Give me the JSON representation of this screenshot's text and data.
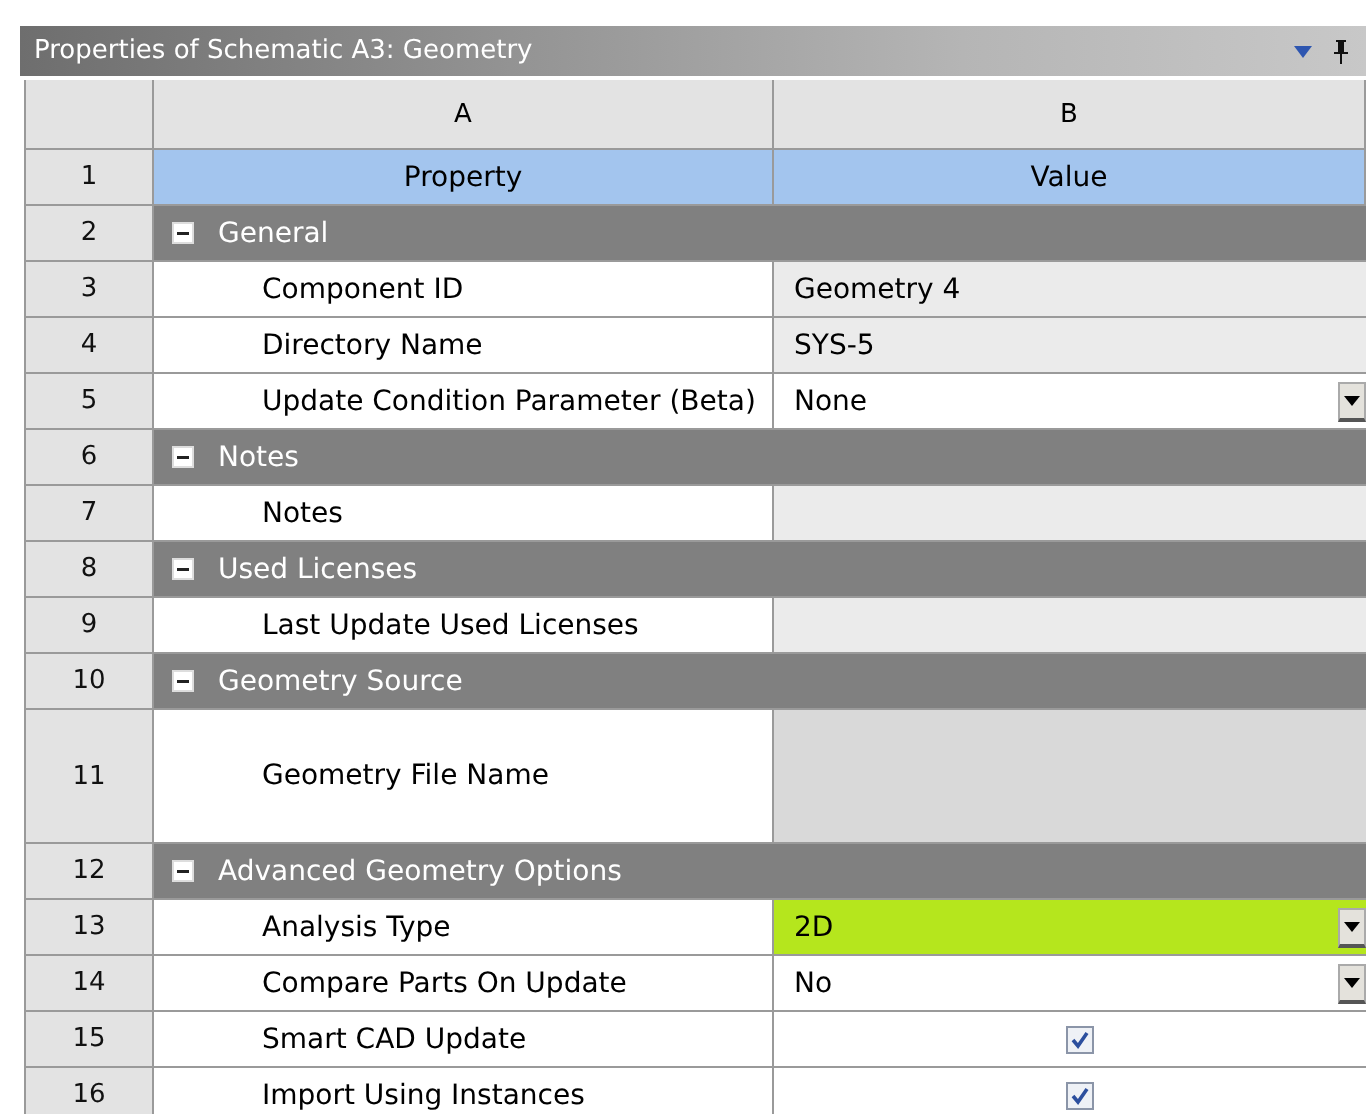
{
  "panel": {
    "title": "Properties of Schematic A3: Geometry"
  },
  "columns": [
    "A",
    "B"
  ],
  "header": {
    "number": "1",
    "property": "Property",
    "value": "Value"
  },
  "rows": [
    {
      "number": "2",
      "kind": "section",
      "label": "General",
      "expanded": true
    },
    {
      "number": "3",
      "kind": "readonly",
      "label": "Component ID",
      "value": "Geometry 4"
    },
    {
      "number": "4",
      "kind": "readonly",
      "label": "Directory Name",
      "value": "SYS-5"
    },
    {
      "number": "5",
      "kind": "dropdown",
      "label": "Update Condition Parameter (Beta)",
      "value": "None",
      "highlighted": false
    },
    {
      "number": "6",
      "kind": "section",
      "label": "Notes",
      "expanded": true
    },
    {
      "number": "7",
      "kind": "readonly",
      "label": "Notes"
    },
    {
      "number": "8",
      "kind": "section",
      "label": "Used Licenses",
      "expanded": true
    },
    {
      "number": "9",
      "kind": "readonly",
      "label": "Last Update Used Licenses"
    },
    {
      "number": "10",
      "kind": "section",
      "label": "Geometry Source",
      "expanded": true
    },
    {
      "number": "11",
      "kind": "file",
      "label": "Geometry File Name"
    },
    {
      "number": "12",
      "kind": "section",
      "label": "Advanced Geometry Options",
      "expanded": true
    },
    {
      "number": "13",
      "kind": "dropdown",
      "label": "Analysis Type",
      "value": "2D",
      "highlighted": true
    },
    {
      "number": "14",
      "kind": "dropdown",
      "label": "Compare Parts On Update",
      "value": "No",
      "highlighted": false
    },
    {
      "number": "15",
      "kind": "checkbox",
      "label": "Smart CAD Update",
      "checked": true
    },
    {
      "number": "16",
      "kind": "checkbox",
      "label": "Import Using Instances",
      "checked": true
    }
  ]
}
